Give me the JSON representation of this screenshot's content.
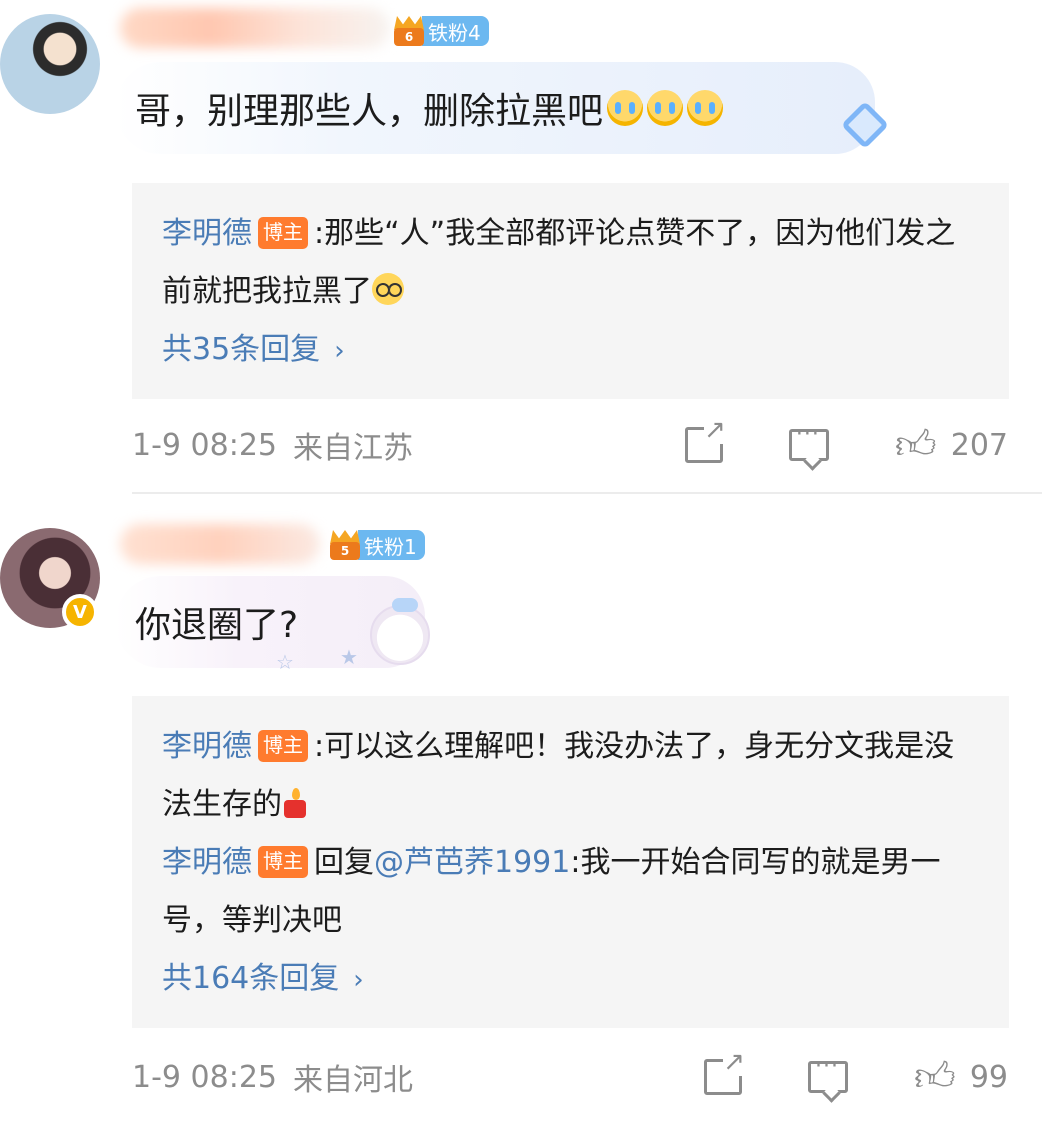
{
  "comments": [
    {
      "fan_badge": {
        "level_label": "铁粉4",
        "crown_digit": "6"
      },
      "text": "哥，别理那些人，删除拉黑吧",
      "emojis": [
        "crying-emoji",
        "crying-emoji",
        "crying-emoji"
      ],
      "replies": [
        {
          "author": "李明德",
          "badge": "博主",
          "text": ":那些“人”我全部都评论点赞不了，因为他们发之前就把我拉黑了",
          "emoji": "glasses-emoji"
        }
      ],
      "more_replies": "共35条回复",
      "time": "1-9 08:25",
      "location": "来自江苏",
      "like_count": "207"
    },
    {
      "fan_badge": {
        "level_label": "铁粉1",
        "crown_digit": "5"
      },
      "text": "你退圈了?",
      "verified": true,
      "replies": [
        {
          "author": "李明德",
          "badge": "博主",
          "text": ":可以这么理解吧！我没办法了，身无分文我是没法生存的",
          "emoji": "candle-emoji"
        },
        {
          "author": "李明德",
          "badge": "博主",
          "prefix": "回复",
          "mention": "@芦芭荞1991",
          "text": ":我一开始合同写的就是男一号，等判决吧"
        }
      ],
      "more_replies": "共164条回复",
      "time": "1-9 08:25",
      "location": "来自河北",
      "like_count": "99"
    }
  ],
  "colors": {
    "link": "#4a7cb6",
    "host_badge": "#ff7b2e",
    "meta": "#8c8c8c",
    "reply_bg": "#f5f5f5"
  },
  "icons": {
    "share": "share-icon",
    "comment": "comment-icon",
    "like": "like-icon",
    "chevron": "chevron-right-icon"
  }
}
